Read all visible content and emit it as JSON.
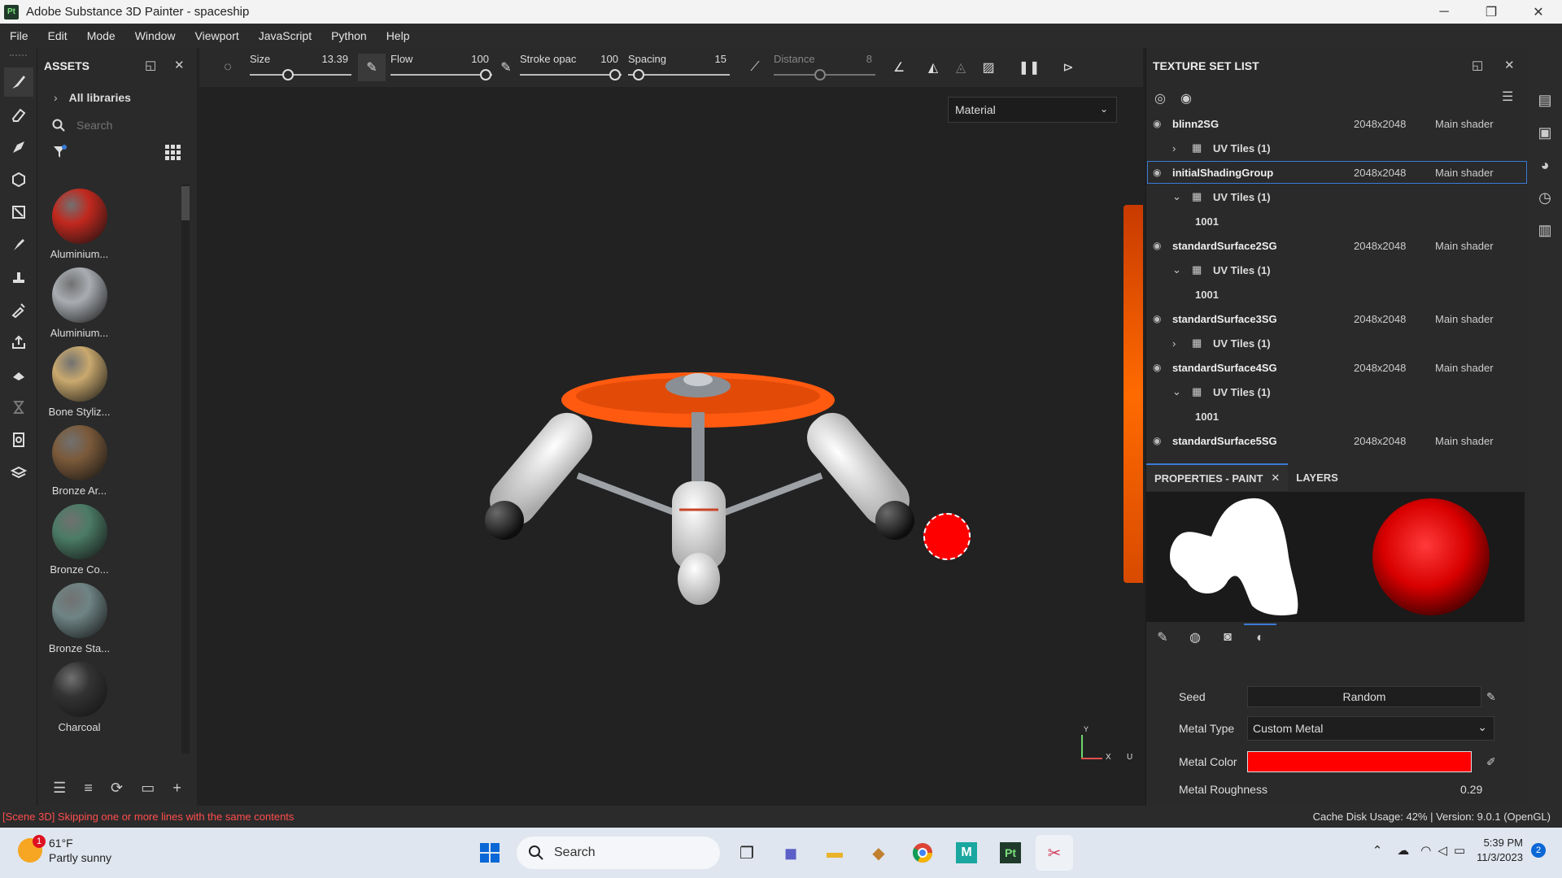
{
  "titlebar": {
    "app_icon": "Pt",
    "title": "Adobe Substance 3D Painter - spaceship",
    "minimize": "─",
    "restore": "❐",
    "close": "✕"
  },
  "menu": [
    "File",
    "Edit",
    "Mode",
    "Window",
    "Viewport",
    "JavaScript",
    "Python",
    "Help"
  ],
  "assets": {
    "title": "ASSETS",
    "library": "All libraries",
    "search_placeholder": "Search",
    "items": [
      {
        "name": "Aluminium...",
        "color": "#c1281e"
      },
      {
        "name": "Aluminium...",
        "color": "#a9adb2"
      },
      {
        "name": "Bone Styliz...",
        "color": "#c9a96e"
      },
      {
        "name": "Bronze Ar...",
        "color": "#7b5a3a"
      },
      {
        "name": "Bronze Co...",
        "color": "#4b7b66"
      },
      {
        "name": "Bronze Sta...",
        "color": "#6f8484"
      },
      {
        "name": "Charcoal",
        "color": "#333333"
      }
    ]
  },
  "toolbar": {
    "size_label": "Size",
    "size_value": "13.39",
    "flow_label": "Flow",
    "flow_value": "100",
    "stroke_label": "Stroke opac",
    "stroke_value": "100",
    "spacing_label": "Spacing",
    "spacing_value": "15",
    "distance_label": "Distance",
    "distance_value": "8"
  },
  "viewport": {
    "mode": "Material",
    "axis_y": "Y",
    "axis_x": "X",
    "axis_u": "U"
  },
  "texture_sets": {
    "title": "TEXTURE SET LIST",
    "rows": [
      {
        "type": "set",
        "name": "blinn2SG",
        "res": "2048x2048",
        "shader": "Main shader"
      },
      {
        "type": "uv",
        "chev": "›",
        "label": "UV Tiles (1)"
      },
      {
        "type": "set",
        "name": "initialShadingGroup",
        "res": "2048x2048",
        "shader": "Main shader",
        "selected": true
      },
      {
        "type": "uv",
        "chev": "⌄",
        "label": "UV Tiles (1)"
      },
      {
        "type": "tile",
        "label": "1001"
      },
      {
        "type": "set",
        "name": "standardSurface2SG",
        "res": "2048x2048",
        "shader": "Main shader"
      },
      {
        "type": "uv",
        "chev": "⌄",
        "label": "UV Tiles (1)"
      },
      {
        "type": "tile",
        "label": "1001"
      },
      {
        "type": "set",
        "name": "standardSurface3SG",
        "res": "2048x2048",
        "shader": "Main shader"
      },
      {
        "type": "uv",
        "chev": "›",
        "label": "UV Tiles (1)"
      },
      {
        "type": "set",
        "name": "standardSurface4SG",
        "res": "2048x2048",
        "shader": "Main shader"
      },
      {
        "type": "uv",
        "chev": "⌄",
        "label": "UV Tiles (1)"
      },
      {
        "type": "tile",
        "label": "1001"
      },
      {
        "type": "set",
        "name": "standardSurface5SG",
        "res": "2048x2048",
        "shader": "Main shader"
      }
    ]
  },
  "properties": {
    "tab_paint": "PROPERTIES - PAINT",
    "tab_layers": "LAYERS",
    "seed_label": "Seed",
    "seed_value": "Random",
    "metal_type_label": "Metal Type",
    "metal_type_value": "Custom Metal",
    "metal_color_label": "Metal Color",
    "metal_color": "#ff0000",
    "roughness_label": "Metal Roughness",
    "roughness_value": "0.29"
  },
  "status": {
    "error": "[Scene 3D] Skipping one or more lines with the same contents",
    "cache": "Cache Disk Usage:  42% | Version: 9.0.1 (OpenGL)"
  },
  "taskbar": {
    "temp": "61°F",
    "weather": "Partly sunny",
    "weather_badge": "1",
    "search": "Search",
    "time": "5:39 PM",
    "date": "11/3/2023",
    "notif": "2"
  }
}
